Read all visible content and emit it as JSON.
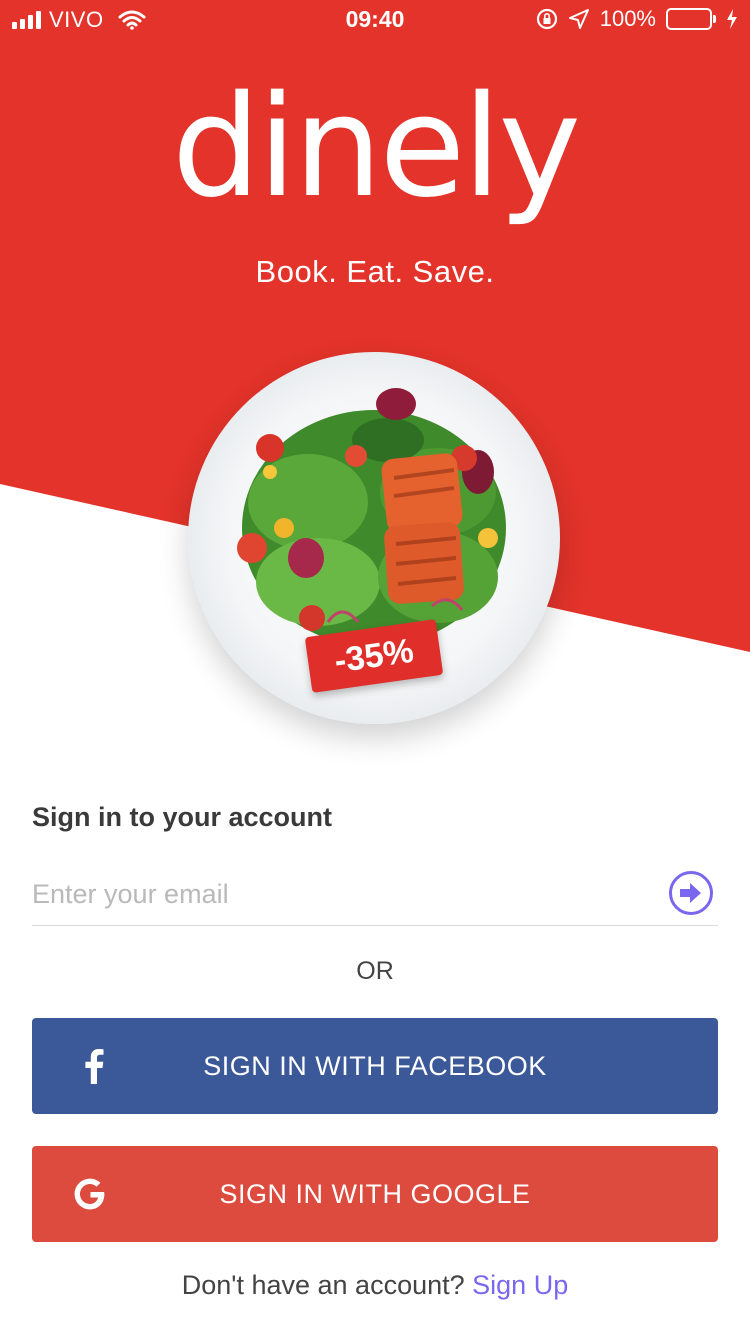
{
  "status_bar": {
    "carrier": "VIVO",
    "time": "09:40",
    "battery": "100%",
    "battery_level": 1.0,
    "icons": [
      "signal-icon",
      "wifi-icon",
      "orientation-lock-icon",
      "location-icon",
      "battery-icon",
      "charging-icon"
    ]
  },
  "brand": {
    "logo": "dinely",
    "tagline": "Book. Eat. Save.",
    "color": "#e3332a"
  },
  "promo": {
    "discount": "-35%"
  },
  "signin": {
    "title": "Sign in to your account",
    "email_placeholder": "Enter your email",
    "email_value": "",
    "submit_icon": "arrow-right-circle-icon",
    "or_label": "OR"
  },
  "social": {
    "facebook": {
      "label": "SIGN IN WITH FACEBOOK",
      "icon": "facebook-icon",
      "color": "#3b5998"
    },
    "google": {
      "label": "SIGN IN WITH GOOGLE",
      "icon": "google-icon",
      "color": "#dc4b3e"
    }
  },
  "footer": {
    "prompt": "Don't have an account?",
    "link": "Sign Up",
    "link_color": "#7a67f0"
  }
}
